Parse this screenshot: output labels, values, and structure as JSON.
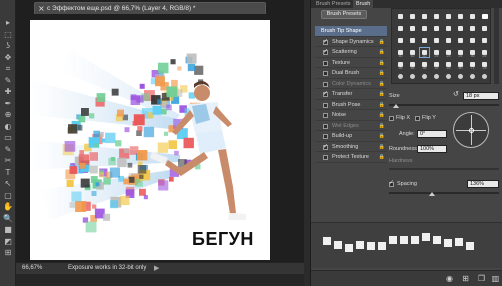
{
  "document": {
    "tab_title": "с Эффектом еще.psd @ 66,7% (Layer 4, RGB/8) *",
    "close_glyph": "×",
    "caption": "БЕГУН"
  },
  "status": {
    "zoom": "66,67%",
    "message": "Exposure works in 32-bit only",
    "arrow": "▶"
  },
  "tools": [
    "▸",
    "⬚",
    "ʖ",
    "✥",
    "⌗",
    "✎",
    "✚",
    "✒",
    "⊕",
    "◐",
    "▭",
    "✎",
    "✂",
    "T",
    "↖",
    "▢",
    "✋",
    "🔍",
    "■",
    "◩",
    "⊞"
  ],
  "panel": {
    "tabs": [
      "Brush Presets",
      "Brush"
    ],
    "active_tab": "Brush",
    "preset_button": "Brush Presets",
    "options": [
      {
        "label": "Brush Tip Shape",
        "checkbox": false,
        "checked": false,
        "lock": false,
        "selected": true
      },
      {
        "label": "Shape Dynamics",
        "checkbox": true,
        "checked": true,
        "lock": true
      },
      {
        "label": "Scattering",
        "checkbox": true,
        "checked": true,
        "lock": true
      },
      {
        "label": "Texture",
        "checkbox": true,
        "checked": false,
        "lock": true
      },
      {
        "label": "Dual Brush",
        "checkbox": true,
        "checked": false,
        "lock": true
      },
      {
        "label": "Color Dynamics",
        "checkbox": true,
        "checked": false,
        "lock": true,
        "dim": true
      },
      {
        "label": "Transfer",
        "checkbox": true,
        "checked": true,
        "lock": true
      },
      {
        "label": "Brush Pose",
        "checkbox": true,
        "checked": false,
        "lock": true
      },
      {
        "label": "Noise",
        "checkbox": true,
        "checked": false,
        "lock": true
      },
      {
        "label": "Wet Edges",
        "checkbox": true,
        "checked": false,
        "lock": true,
        "dim": true
      },
      {
        "label": "Build-up",
        "checkbox": true,
        "checked": false,
        "lock": true
      },
      {
        "label": "Smoothing",
        "checkbox": true,
        "checked": true,
        "lock": true
      },
      {
        "label": "Protect Texture",
        "checkbox": true,
        "checked": false,
        "lock": true
      }
    ],
    "brush_tip_numbers": [
      "30",
      "30",
      "30",
      "25",
      "25",
      "25",
      "36",
      "25",
      "36",
      "36",
      "36",
      "32",
      "25",
      "50",
      "71",
      "25",
      "50",
      "71"
    ],
    "size_label": "Size",
    "size_value": "18 px",
    "flip_x_label": "Flip X",
    "flip_y_label": "Flip Y",
    "angle_label": "Angle:",
    "angle_value": "0°",
    "roundness_label": "Roundness:",
    "roundness_value": "100%",
    "hardness_label": "Hardness",
    "spacing_label": "Spacing",
    "spacing_value": "136%",
    "spacing_checked": true,
    "footer_icons": [
      "create-new-icon",
      "grid-icon",
      "trash-icon"
    ]
  }
}
